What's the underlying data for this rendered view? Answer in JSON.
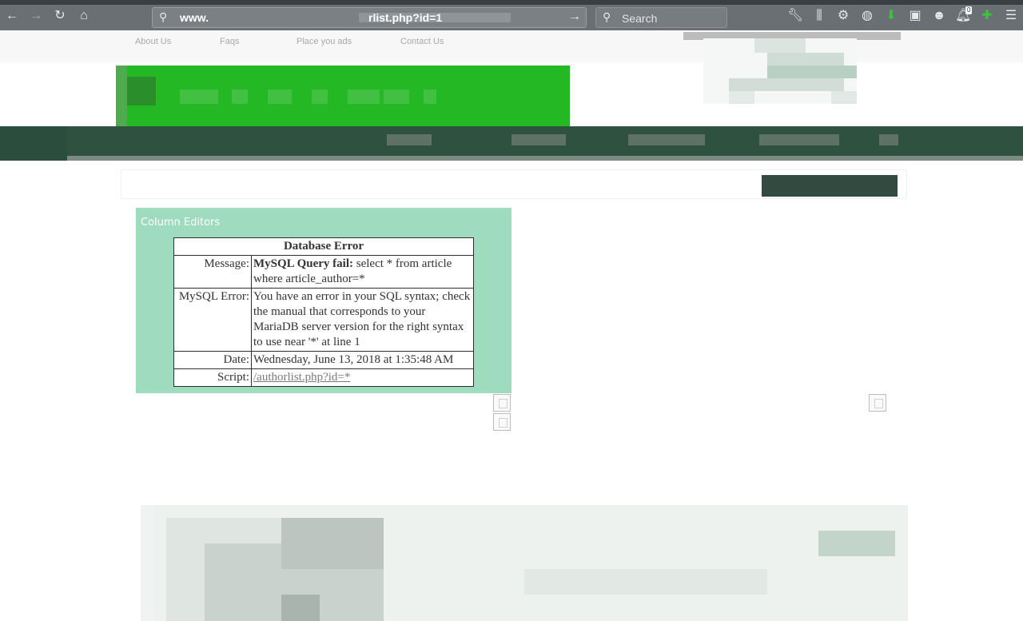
{
  "browser": {
    "url_prefix": "www.",
    "url_suffix": "rlist.php?id=1",
    "search_placeholder": "Search",
    "notification_count": "0"
  },
  "nav": {
    "about": "About Us",
    "faqs": "Faqs",
    "place_ads": "Place you ads",
    "contact": "Contact Us"
  },
  "panel": {
    "title": "Column Editors"
  },
  "error": {
    "heading": "Database Error",
    "message_label": "Message:",
    "message_strong": "MySQL Query fail:",
    "message_text": " select * from article where article_author=*",
    "mysql_label": "MySQL Error:",
    "mysql_text": "You have an error in your SQL syntax; check the manual that corresponds to your MariaDB server version for the right syntax to use near '*' at line 1",
    "date_label": "Date:",
    "date_text": "Wednesday, June 13, 2018 at 1:35:48 AM",
    "script_label": "Script:",
    "script_link": "/authorlist.php?id=*"
  },
  "colors": {
    "toolbar": "#6a6f73",
    "logo_green": "#24b924",
    "band": "#2b4d3d",
    "panel": "#9fdbbf"
  }
}
